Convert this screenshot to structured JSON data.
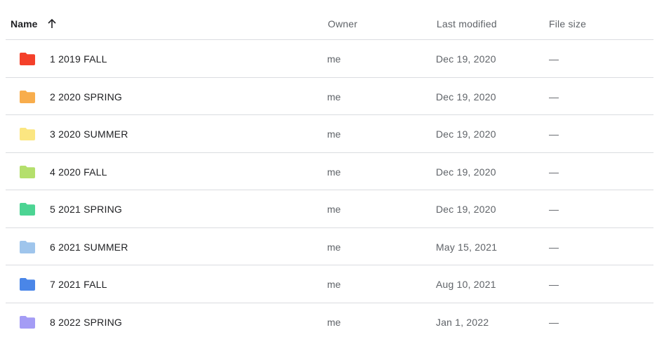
{
  "header": {
    "name": "Name",
    "owner": "Owner",
    "last_modified": "Last modified",
    "file_size": "File size",
    "sort_icon": "arrow-up-icon"
  },
  "rows": [
    {
      "name": "1 2019 FALL",
      "owner": "me",
      "modified": "Dec 19, 2020",
      "size": "—",
      "color": "#f4402a",
      "icon": "folder-icon"
    },
    {
      "name": "2 2020 SPRING",
      "owner": "me",
      "modified": "Dec 19, 2020",
      "size": "—",
      "color": "#f8ad4c",
      "icon": "folder-icon"
    },
    {
      "name": "3 2020 SUMMER",
      "owner": "me",
      "modified": "Dec 19, 2020",
      "size": "—",
      "color": "#fbe681",
      "icon": "folder-icon"
    },
    {
      "name": "4 2020 FALL",
      "owner": "me",
      "modified": "Dec 19, 2020",
      "size": "—",
      "color": "#b4df6c",
      "icon": "folder-icon"
    },
    {
      "name": "5 2021 SPRING",
      "owner": "me",
      "modified": "Dec 19, 2020",
      "size": "—",
      "color": "#4cd493",
      "icon": "folder-icon"
    },
    {
      "name": "6 2021 SUMMER",
      "owner": "me",
      "modified": "May 15, 2021",
      "size": "—",
      "color": "#9fc5ec",
      "icon": "folder-icon"
    },
    {
      "name": "7 2021 FALL",
      "owner": "me",
      "modified": "Aug 10, 2021",
      "size": "—",
      "color": "#4a86e8",
      "icon": "folder-icon"
    },
    {
      "name": "8 2022 SPRING",
      "owner": "me",
      "modified": "Jan 1, 2022",
      "size": "—",
      "color": "#a49cf5",
      "icon": "folder-icon"
    }
  ]
}
